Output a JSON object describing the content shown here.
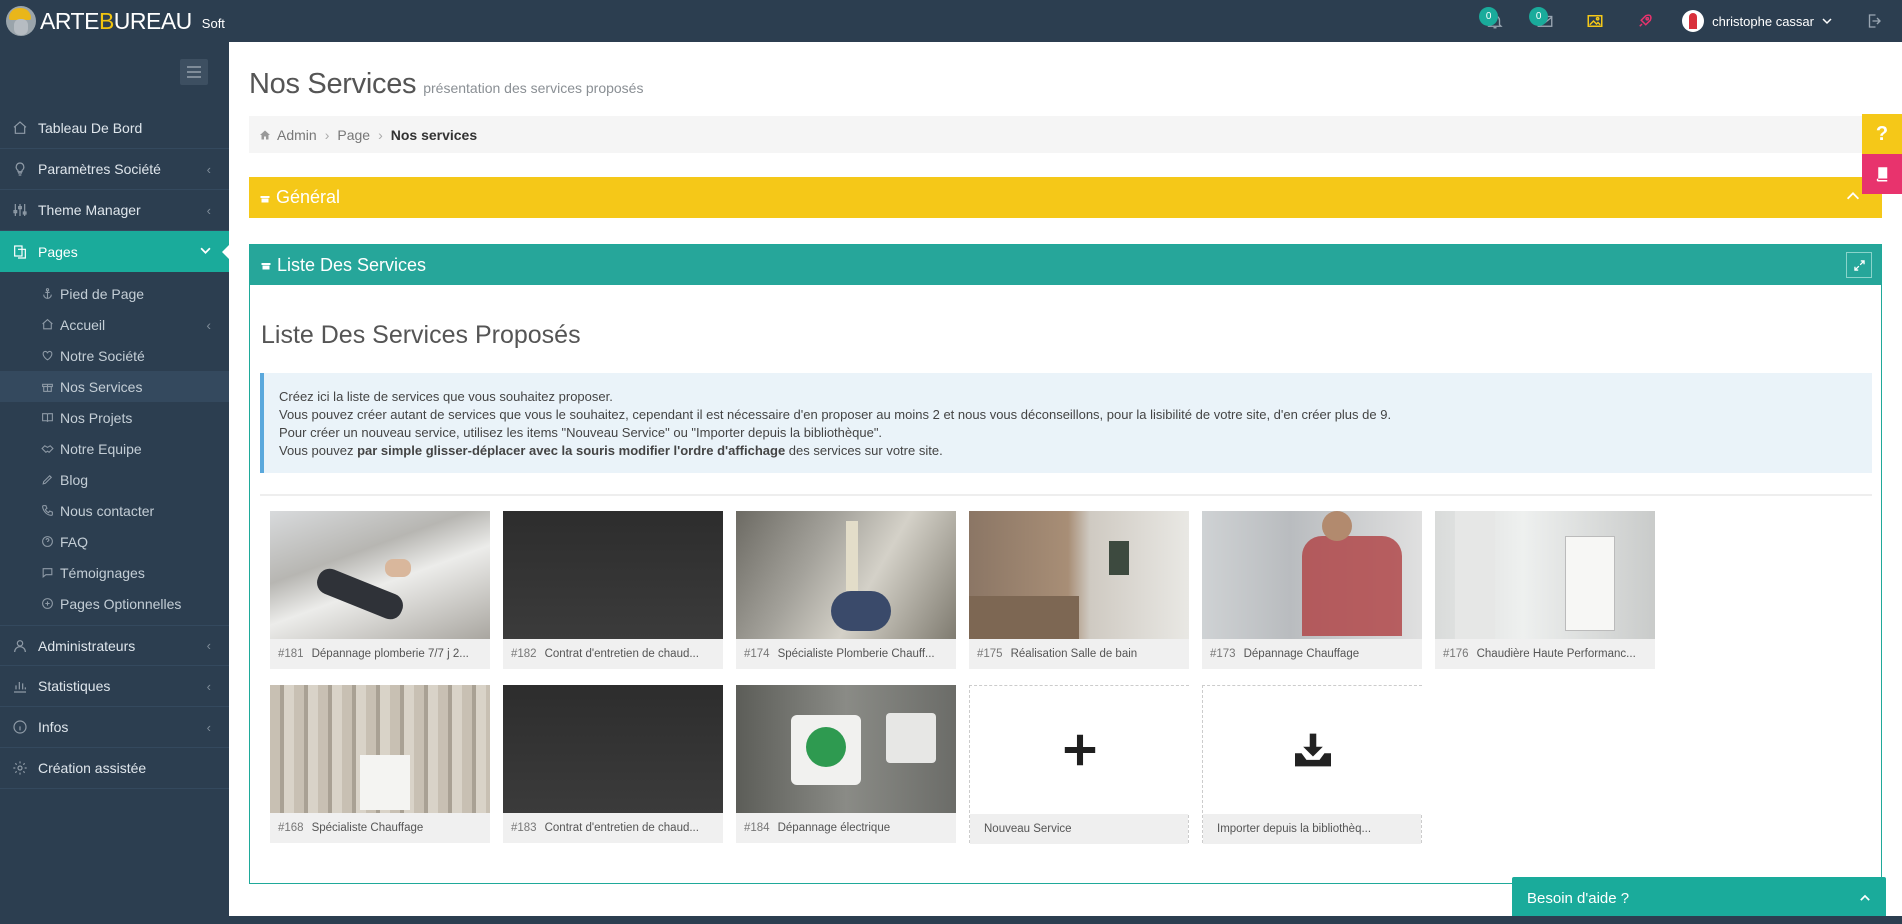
{
  "brand": {
    "name_part1": "ARTE",
    "name_accent": "B",
    "name_part2": "UREAU",
    "suffix": "Soft"
  },
  "topbar": {
    "notifications_count": "0",
    "messages_count": "0",
    "user_name": "christophe cassar"
  },
  "sidebar": {
    "items": [
      {
        "label": "Tableau De Bord",
        "icon": "home-icon"
      },
      {
        "label": "Paramètres Société",
        "icon": "lightbulb-icon"
      },
      {
        "label": "Theme Manager",
        "icon": "sliders-icon"
      },
      {
        "label": "Pages",
        "icon": "pages-icon"
      }
    ],
    "sub_items": [
      {
        "label": "Pied de Page",
        "icon": "anchor-icon"
      },
      {
        "label": "Accueil",
        "icon": "home-icon"
      },
      {
        "label": "Notre Société",
        "icon": "heart-icon"
      },
      {
        "label": "Nos Services",
        "icon": "gift-icon"
      },
      {
        "label": "Nos Projets",
        "icon": "book-icon"
      },
      {
        "label": "Notre Equipe",
        "icon": "handshake-icon"
      },
      {
        "label": "Blog",
        "icon": "pen-icon"
      },
      {
        "label": "Nous contacter",
        "icon": "phone-icon"
      },
      {
        "label": "FAQ",
        "icon": "question-icon"
      },
      {
        "label": "Témoignages",
        "icon": "comment-icon"
      },
      {
        "label": "Pages Optionnelles",
        "icon": "plus-circle-icon"
      }
    ],
    "items_after": [
      {
        "label": "Administrateurs",
        "icon": "user-icon"
      },
      {
        "label": "Statistiques",
        "icon": "bar-chart-icon"
      },
      {
        "label": "Infos",
        "icon": "info-icon"
      },
      {
        "label": "Création assistée",
        "icon": "gear-icon"
      }
    ]
  },
  "page": {
    "title": "Nos Services",
    "subtitle": "présentation des services proposés"
  },
  "breadcrumb": {
    "home": "Admin",
    "page": "Page",
    "current": "Nos services"
  },
  "panel_general": {
    "title": "Général"
  },
  "panel_list": {
    "title": "Liste Des Services",
    "heading": "Liste Des Services Proposés"
  },
  "info": {
    "line1": "Créez ici la liste de services que vous souhaitez proposer.",
    "line2": "Vous pouvez créer autant de services que vous le souhaitez, cependant il est nécessaire d'en proposer au moins 2 et nous vous déconseillons, pour la lisibilité de votre site, d'en créer plus de 9.",
    "line3": "Pour créer un nouveau service, utilisez les items \"Nouveau Service\" ou \"Importer depuis la bibliothèque\".",
    "line4_before": "Vous pouvez ",
    "line4_bold": "par simple glisser-déplacer avec la souris modifier l'ordre d'affichage",
    "line4_after": " des services sur votre site."
  },
  "services": [
    {
      "id": "#181",
      "label": "Dépannage plomberie 7/7 j 2..."
    },
    {
      "id": "#182",
      "label": "Contrat d'entretien de chaud..."
    },
    {
      "id": "#174",
      "label": "Spécialiste Plomberie Chauff..."
    },
    {
      "id": "#175",
      "label": "Réalisation Salle de bain"
    },
    {
      "id": "#173",
      "label": "Dépannage Chauffage"
    },
    {
      "id": "#176",
      "label": "Chaudière Haute Performanc..."
    },
    {
      "id": "#168",
      "label": "Spécialiste Chauffage"
    },
    {
      "id": "#183",
      "label": "Contrat d'entretien de chaud..."
    },
    {
      "id": "#184",
      "label": "Dépannage électrique"
    }
  ],
  "actions": {
    "new_service": "Nouveau Service",
    "import": "Importer depuis la bibliothèq..."
  },
  "help": {
    "question": "?",
    "need_help": "Besoin d'aide ?"
  },
  "colors": {
    "sidebar": "#2c3e50",
    "accent_teal": "#1aab9b",
    "accent_yellow": "#f5c818",
    "accent_pink": "#e8336d"
  }
}
